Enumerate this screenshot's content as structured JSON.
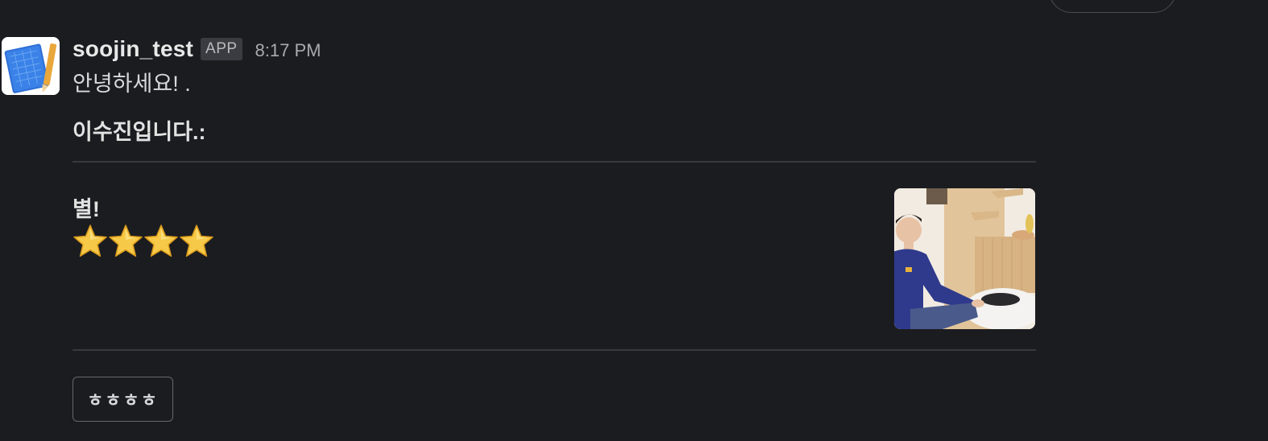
{
  "message": {
    "username": "soojin_test",
    "badge": "APP",
    "timestamp": "8:17 PM",
    "greeting": "안녕하세요! .",
    "intro": "이수진입니다.:"
  },
  "section": {
    "title": "별!",
    "stars": 4,
    "star_icon": "star-icon",
    "thumbnail_icon": "person-photo"
  },
  "actions": {
    "button_label": "ㅎㅎㅎㅎ"
  },
  "colors": {
    "background": "#1b1c20",
    "divider": "#393a3e",
    "badge_bg": "#3b3c41",
    "star": "#f7c948"
  }
}
